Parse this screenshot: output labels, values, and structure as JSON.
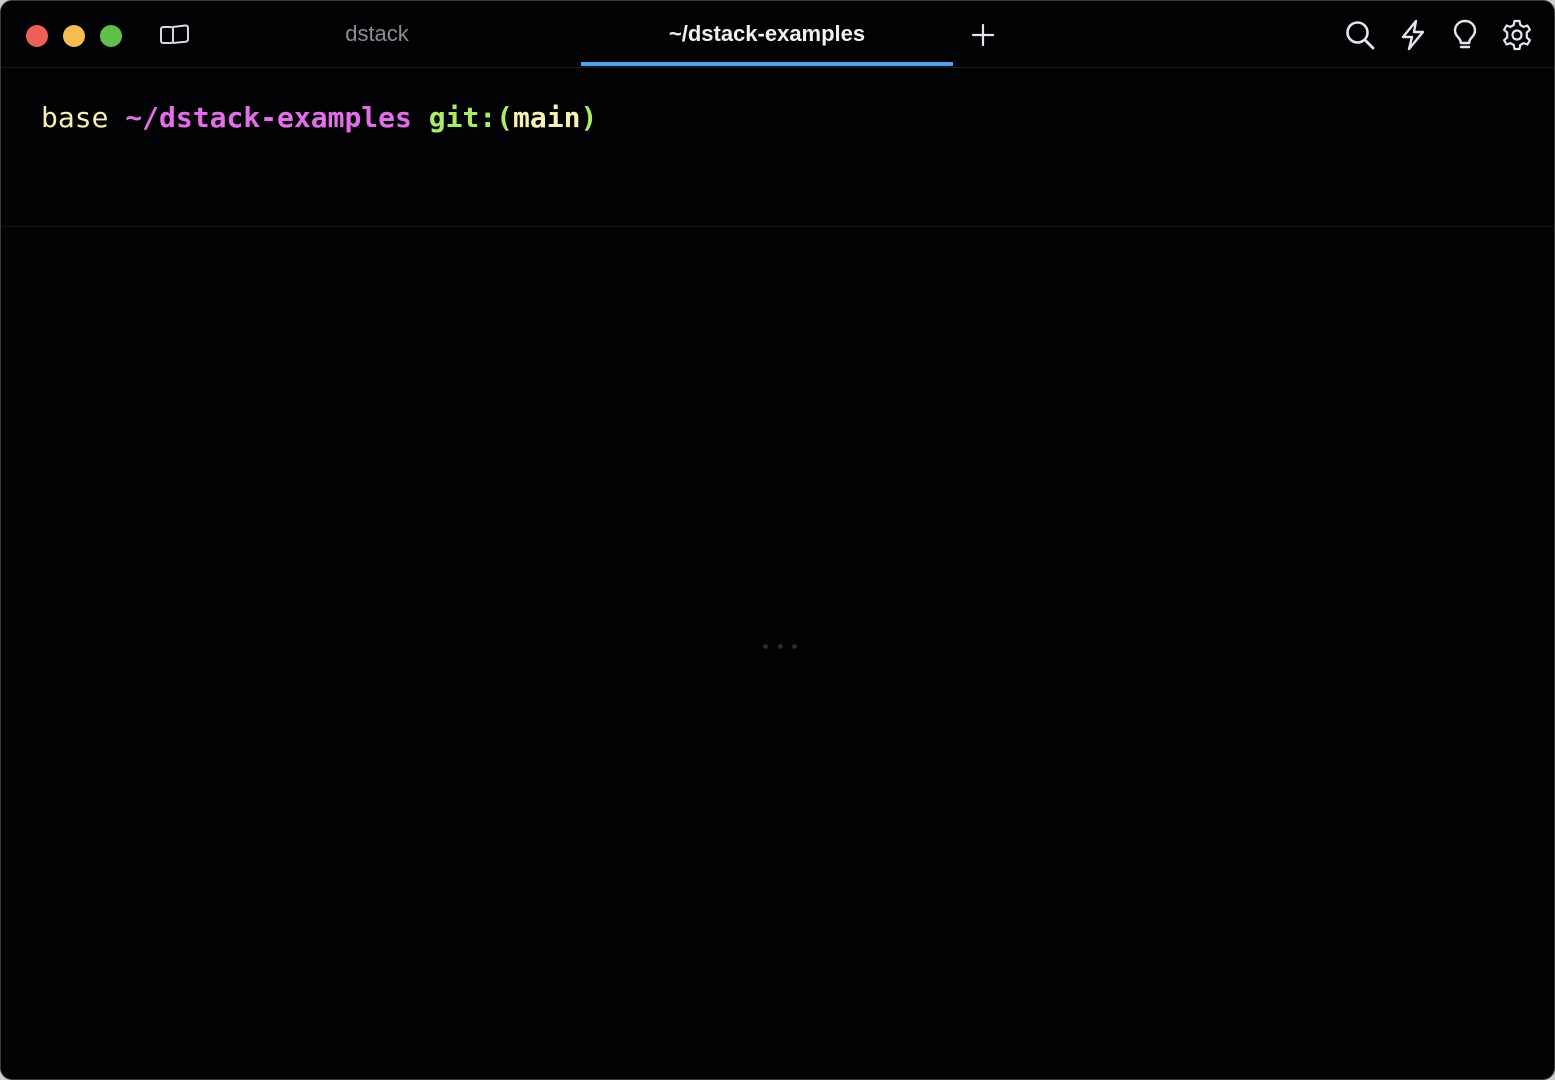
{
  "window": {
    "controls": {
      "close": "close-window",
      "minimize": "minimize-window",
      "maximize": "maximize-window"
    }
  },
  "tabs": [
    {
      "label": "dstack",
      "active": false
    },
    {
      "label": "~/dstack-examples",
      "active": true
    }
  ],
  "toolbar": {
    "icons": [
      "search-icon",
      "lightning-icon",
      "lightbulb-icon",
      "gear-icon"
    ]
  },
  "terminal": {
    "prompt": {
      "env": "base",
      "path": "~/dstack-examples",
      "git_prefix": "git:(",
      "branch": "main",
      "git_suffix": ")"
    }
  },
  "colors": {
    "background": "#020204",
    "accent": "#4aa3f0",
    "prompt_env": "#f4f0b0",
    "prompt_path": "#e46ee9",
    "prompt_git": "#a8ed63"
  }
}
